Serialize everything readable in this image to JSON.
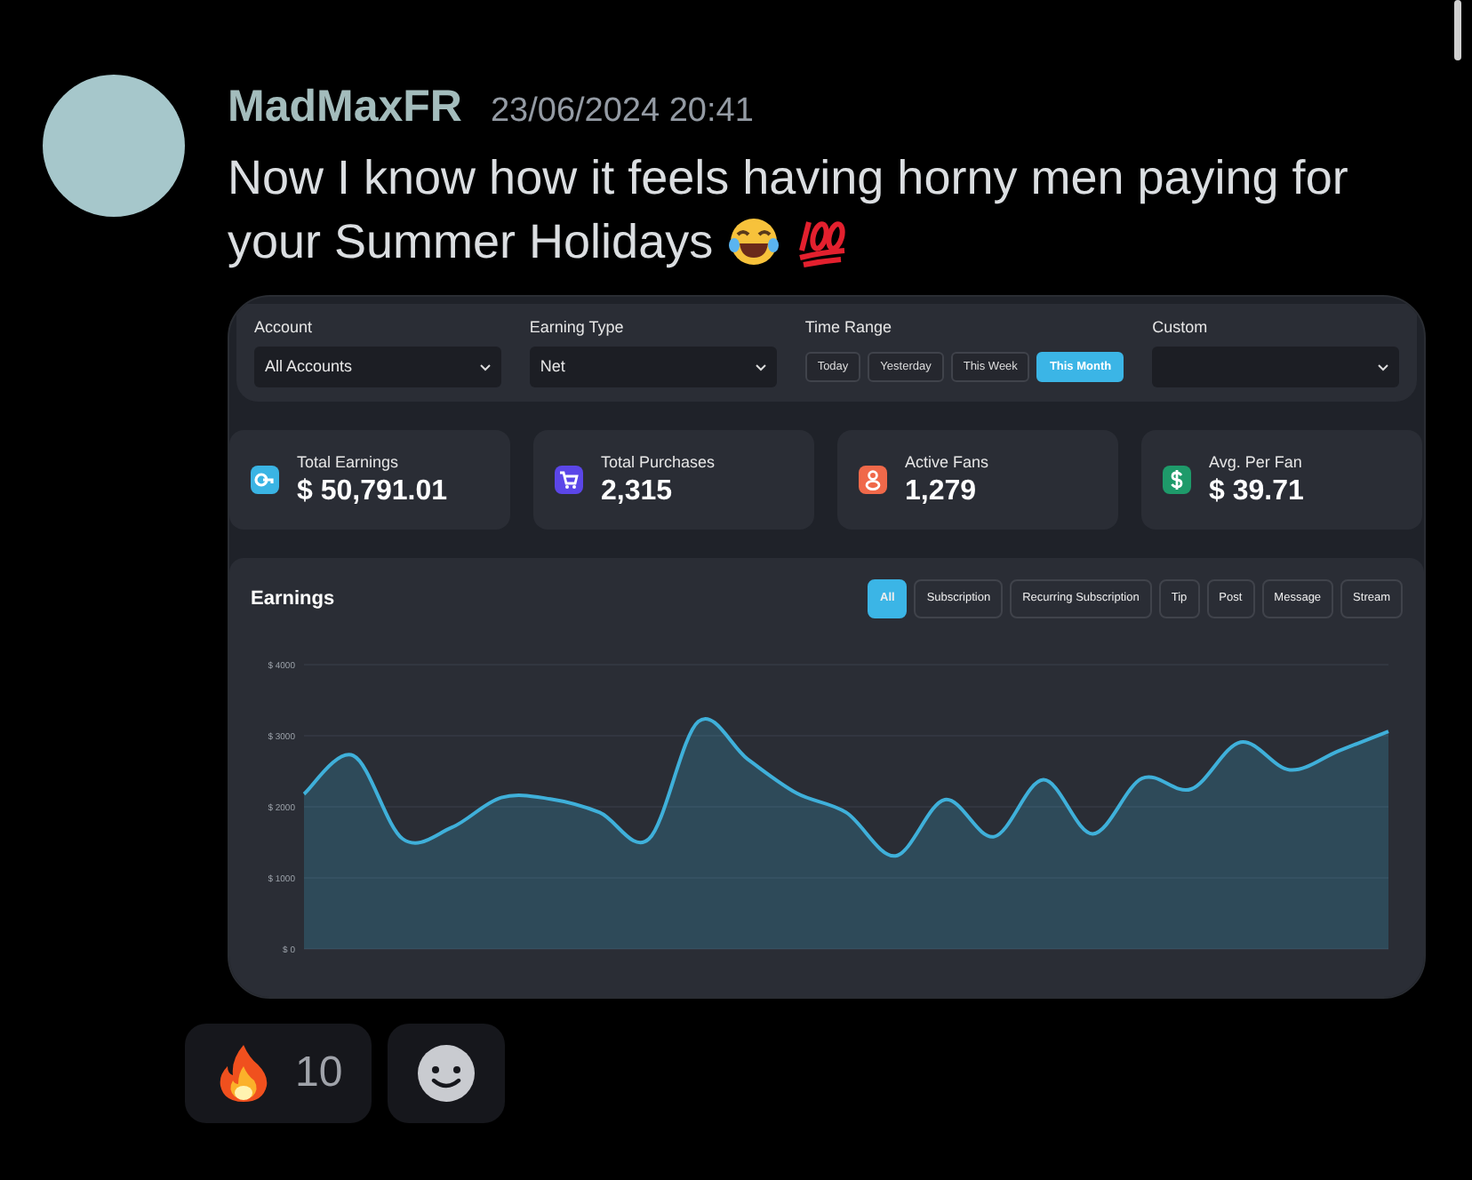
{
  "message": {
    "author": "MadMaxFR",
    "timestamp": "23/06/2024 20:41",
    "text_lines": [
      "Now I know how it feels having horny men paying for",
      "your Summer Holidays"
    ]
  },
  "dashboard": {
    "filters": [
      {
        "kind": "select",
        "label": "Account",
        "value": "All Accounts"
      },
      {
        "kind": "select",
        "label": "Earning Type",
        "value": "Net"
      },
      {
        "kind": "range",
        "label": "Time Range",
        "options": [
          {
            "label": "Today",
            "selected": false
          },
          {
            "label": "Yesterday",
            "selected": false
          },
          {
            "label": "This Week",
            "selected": false
          },
          {
            "label": "This Month",
            "selected": true
          }
        ]
      },
      {
        "kind": "select",
        "label": "Custom"
      }
    ],
    "stats": [
      {
        "kind": "earnings",
        "label": "Total Earnings",
        "value": "$ 50,791.01",
        "color": "#3ab4e4"
      },
      {
        "kind": "purchases",
        "label": "Total Purchases",
        "value": "2,315",
        "color": "#5b46e8"
      },
      {
        "kind": "fans",
        "label": "Active Fans",
        "value": "1,279",
        "color": "#f0694a"
      },
      {
        "kind": "average",
        "label": "Avg. Per Fan",
        "value": "$ 39.71",
        "color": "#1e9a6a"
      }
    ],
    "earnings": {
      "title": "Earnings",
      "filters": [
        {
          "label": "All",
          "selected": true
        },
        {
          "label": "Subscription",
          "selected": false
        },
        {
          "label": "Recurring Subscription",
          "selected": false
        },
        {
          "label": "Tip",
          "selected": false
        },
        {
          "label": "Post",
          "selected": false
        },
        {
          "label": "Message",
          "selected": false
        },
        {
          "label": "Stream",
          "selected": false
        }
      ],
      "chart_data": {
        "type": "area",
        "grid": true,
        "series": [
          {
            "color": "#3fb0da",
            "values": [
              2180,
              2720,
              1550,
              1710,
              2130,
              2110,
              1920,
              1550,
              3200,
              2670,
              2190,
              1920,
              1310,
              2100,
              1580,
              2380,
              1620,
              2400,
              2250,
              2910,
              2520,
              2790,
              3060
            ]
          }
        ],
        "ylim": [
          0,
          4000
        ],
        "yticks": [
          {
            "value": 0,
            "label": "$ 0"
          },
          {
            "value": 1000,
            "label": "$ 1000"
          },
          {
            "value": 2000,
            "label": "$ 2000"
          },
          {
            "value": 3000,
            "label": "$ 3000"
          },
          {
            "value": 4000,
            "label": "$ 4000"
          }
        ]
      }
    }
  },
  "reactions": [
    {
      "kind": "emoji",
      "count": "10"
    },
    {
      "kind": "add"
    }
  ]
}
